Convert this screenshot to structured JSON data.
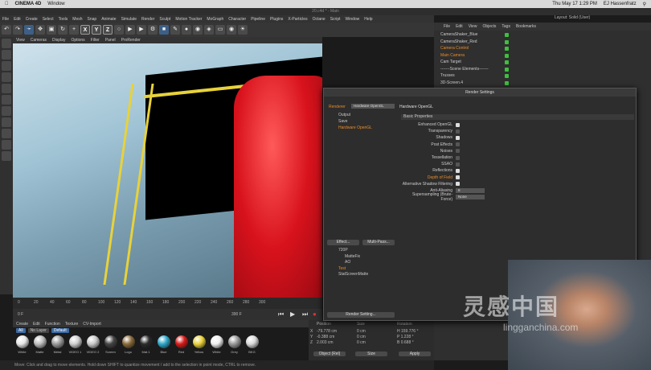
{
  "mac_menu": {
    "app": "CINEMA 4D",
    "window": "Window",
    "date": "Thu May 17 1:29 PM",
    "user": "EJ Hassenfratz"
  },
  "doc_title": "20.c4d * - Main",
  "c4d_menu": [
    "File",
    "Edit",
    "Create",
    "Select",
    "Tools",
    "Mesh",
    "Snap",
    "Animate",
    "Simulate",
    "Render",
    "Sculpt",
    "Motion Tracker",
    "MoGraph",
    "Character",
    "Pipeline",
    "Plugins",
    "X-Particles",
    "Octane",
    "Script",
    "Window",
    "Help"
  ],
  "layout": "Layout: Solid (User)",
  "viewport_menu": [
    "View",
    "Cameras",
    "Display",
    "Options",
    "Filter",
    "Panel",
    "ProRender"
  ],
  "xyz": [
    "X",
    "Y",
    "Z"
  ],
  "objects_menu": [
    "File",
    "Edit",
    "View",
    "Objects",
    "Tags",
    "Bookmarks"
  ],
  "objects": [
    {
      "name": "CameraShaker_Blue",
      "selected": false
    },
    {
      "name": "CameraShaker_Red",
      "selected": false
    },
    {
      "name": "Camera Control",
      "selected": true
    },
    {
      "name": "Main Camera",
      "selected": true
    },
    {
      "name": "Cam Target",
      "selected": false
    },
    {
      "name": "-------Scene Elements-------",
      "selected": false
    },
    {
      "name": "Trusses",
      "selected": false
    },
    {
      "name": "3D-Screen.4",
      "selected": false
    }
  ],
  "render_settings": {
    "title": "Render Settings",
    "renderer_label": "Renderer",
    "renderer_value": "Hardware OpenGL",
    "left_items": [
      "Output",
      "Save",
      "Hardware OpenGL"
    ],
    "section_title": "Hardware OpenGL",
    "subsection": "Basic Properties",
    "props": [
      {
        "label": "Enhanced OpenGL",
        "checked": true
      },
      {
        "label": "Transparency",
        "checked": false
      },
      {
        "label": "Shadows",
        "checked": true
      },
      {
        "label": "Post Effects",
        "checked": false
      },
      {
        "label": "Noises",
        "checked": false
      },
      {
        "label": "Tessellation",
        "checked": false
      },
      {
        "label": "SSAO",
        "checked": false
      },
      {
        "label": "Reflections",
        "checked": true
      },
      {
        "label": "Depth of Field",
        "checked": true
      },
      {
        "label": "Alternative Shadow Filtering",
        "checked": true
      }
    ],
    "aa_label": "Anti-Aliasing",
    "aa_value": "8",
    "ss_label": "Supersampling (Brute-Force)",
    "ss_value": "None",
    "effect_btn": "Effect...",
    "multipass_btn": "Multi-Pass...",
    "presets": [
      "720P",
      "MatteFix",
      "AO",
      "Test",
      "StatScreenMatte"
    ],
    "render_setting_btn": "Render Setting..."
  },
  "timeline_ticks": [
    "0",
    "20",
    "40",
    "60",
    "80",
    "100",
    "120",
    "140",
    "160",
    "180",
    "200",
    "220",
    "240",
    "260",
    "280",
    "300"
  ],
  "playback": {
    "start": "0 F",
    "end": "390 F",
    "current": "0 F"
  },
  "mat_menu": [
    "Create",
    "Edit",
    "Function",
    "Texture",
    "CV-Import"
  ],
  "mat_filters": [
    {
      "label": "All",
      "on": true
    },
    {
      "label": "No Layer",
      "on": false
    },
    {
      "label": "Default",
      "on": true
    }
  ],
  "materials": [
    {
      "name": "White",
      "color": "#e8e8e8"
    },
    {
      "name": "Matte",
      "color": "#bdbdbd"
    },
    {
      "name": "Metal",
      "color": "#9a9a9a"
    },
    {
      "name": "VIDEO 1",
      "color": "#cfcfcf"
    },
    {
      "name": "VIDEO 2",
      "color": "#c9c9c9"
    },
    {
      "name": "Screen",
      "color": "#444444"
    },
    {
      "name": "Logo",
      "color": "#8a6a3a"
    },
    {
      "name": "Mat.1",
      "color": "#2b2b2b"
    },
    {
      "name": "Blue",
      "color": "#2fa8c9"
    },
    {
      "name": "Red",
      "color": "#d91a1a"
    },
    {
      "name": "Yellow",
      "color": "#e9d23a"
    },
    {
      "name": "White",
      "color": "#f0f0f0"
    },
    {
      "name": "Grey",
      "color": "#999999"
    },
    {
      "name": "BKG",
      "color": "#d9d9d9"
    }
  ],
  "coords": {
    "headers": [
      "Position",
      "Size",
      "Rotation"
    ],
    "rows": [
      {
        "axis": "X",
        "pos": "-79.778 cm",
        "size": "0 cm",
        "rot": "H 159.776 °"
      },
      {
        "axis": "Y",
        "pos": "-0.388 cm",
        "size": "0 cm",
        "rot": "P 1.228 °"
      },
      {
        "axis": "Z",
        "pos": "2.003 cm",
        "size": "0 cm",
        "rot": "B 0.688 °"
      }
    ],
    "mode": "Object (Rel)",
    "size_mode": "Size",
    "apply": "Apply"
  },
  "status": "Move: Click and drag to move elements. Hold down SHIFT to quantize movement / add to the selection in point mode, CTRL to remove.",
  "watermark": {
    "cn": "灵感中国",
    "url": "lingganchina.com"
  }
}
